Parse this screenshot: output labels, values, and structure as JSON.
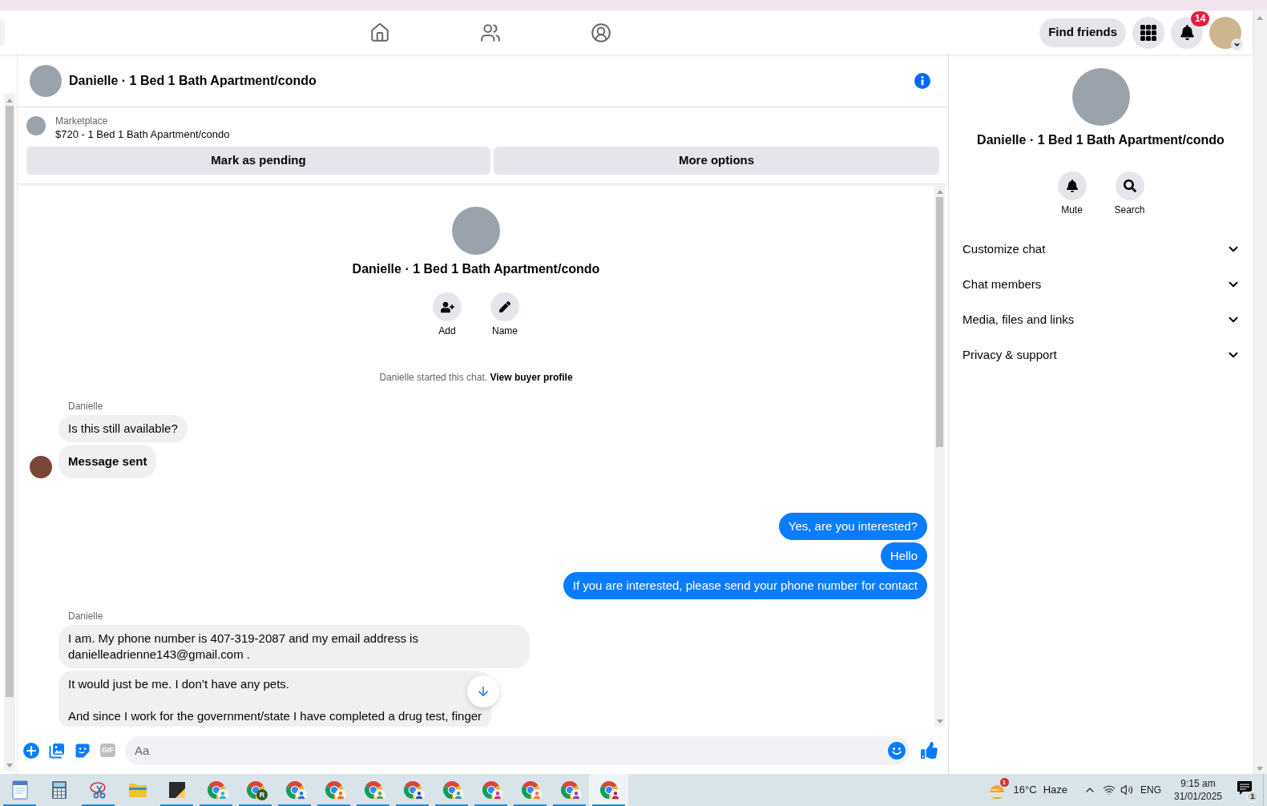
{
  "top_nav": {
    "tabs": [
      {
        "kind": "home",
        "selected": false
      },
      {
        "kind": "friends",
        "selected": false
      },
      {
        "kind": "groups",
        "selected": false
      }
    ],
    "find_friends": "Find friends",
    "notification_count": "14"
  },
  "conversation": {
    "title": "Danielle · 1 Bed 1 Bath Apartment/condo",
    "listing": {
      "source": "Marketplace",
      "title": "$720 - 1 Bed 1 Bath Apartment/condo"
    },
    "listing_actions": [
      "Mark as pending",
      "More options"
    ]
  },
  "chat_intro": {
    "title": "Danielle · 1 Bed 1 Bath Apartment/condo",
    "actions": [
      {
        "kind": "add",
        "label": "Add"
      },
      {
        "kind": "name",
        "label": "Name"
      }
    ],
    "notice": "Danielle started this chat.",
    "notice_link": "View buyer profile"
  },
  "message_groups": [
    {
      "outgoing": false,
      "sender": "Danielle",
      "show_avatar": true,
      "messages": [
        {
          "kind": "text",
          "text": "Is this still available?"
        },
        {
          "kind": "status",
          "text": "Message sent"
        }
      ]
    },
    {
      "outgoing": true,
      "show_avatar": false,
      "messages": [
        {
          "kind": "text",
          "text": "Yes, are you interested?"
        },
        {
          "kind": "text",
          "text": "Hello"
        },
        {
          "kind": "text",
          "text": "If you are interested, please send your phone number for contact"
        }
      ]
    },
    {
      "outgoing": false,
      "sender": "Danielle",
      "show_avatar": false,
      "messages": [
        {
          "kind": "text",
          "text": "I am. My phone number is 407-319-2087 and my email address is danielleadrienne143@gmail.com ."
        },
        {
          "kind": "paragraphs",
          "paragraphs": [
            "It would just be me. I don’t have any pets.",
            "And since I work for the government/state I have completed a drug test, finger"
          ]
        }
      ]
    }
  ],
  "composer": {
    "tools": [
      {
        "kind": "plus",
        "disabled": false
      },
      {
        "kind": "photo",
        "disabled": false
      },
      {
        "kind": "sticker",
        "disabled": false
      },
      {
        "kind": "gif",
        "label": "GIF",
        "disabled": true
      }
    ],
    "placeholder": "Aa"
  },
  "details_panel": {
    "title": "Danielle · 1 Bed 1 Bath Apartment/condo",
    "actions": [
      {
        "kind": "mute",
        "label": "Mute"
      },
      {
        "kind": "search",
        "label": "Search"
      }
    ],
    "sections": [
      {
        "label": "Customize chat",
        "expanded": false
      },
      {
        "label": "Chat members",
        "expanded": false
      },
      {
        "label": "Media, files and links",
        "expanded": false
      },
      {
        "label": "Privacy & support",
        "expanded": false
      }
    ]
  },
  "taskbar": {
    "apps": [
      {
        "kind": "wordpad",
        "running": true,
        "selected": false
      },
      {
        "kind": "calculator",
        "running": false,
        "selected": false
      },
      {
        "kind": "snipping",
        "running": true,
        "selected": false
      },
      {
        "kind": "explorer",
        "running": false,
        "selected": false
      },
      {
        "kind": "sticky-notes",
        "running": true,
        "selected": false
      },
      {
        "kind": "chrome",
        "running": true,
        "selected": false,
        "color": "#2bb3d1"
      },
      {
        "kind": "chrome",
        "running": true,
        "selected": false,
        "color": "#2e5b2a",
        "badge": "R"
      },
      {
        "kind": "chrome",
        "running": true,
        "selected": false,
        "color": "#1a73e8"
      },
      {
        "kind": "chrome",
        "running": true,
        "selected": false,
        "color": "#e8710a"
      },
      {
        "kind": "chrome",
        "running": true,
        "selected": false,
        "color": "#5f9e57"
      },
      {
        "kind": "chrome",
        "running": true,
        "selected": false,
        "color": "#2f4fa8"
      },
      {
        "kind": "chrome",
        "running": true,
        "selected": false,
        "color": "#3f9a9c"
      },
      {
        "kind": "chrome",
        "running": true,
        "selected": false,
        "color": "#d63384"
      },
      {
        "kind": "chrome",
        "running": true,
        "selected": false,
        "color": "#ef7a3a"
      },
      {
        "kind": "chrome",
        "running": true,
        "selected": false,
        "color": "#8e44ad"
      },
      {
        "kind": "chrome",
        "running": true,
        "selected": true,
        "color": "#c2185b"
      }
    ],
    "weather": {
      "badge": "1",
      "temperature": "16°C",
      "condition": "Haze"
    },
    "language": "ENG",
    "time": "9:15 am",
    "date": "31/01/2025",
    "notification_count": "1"
  }
}
